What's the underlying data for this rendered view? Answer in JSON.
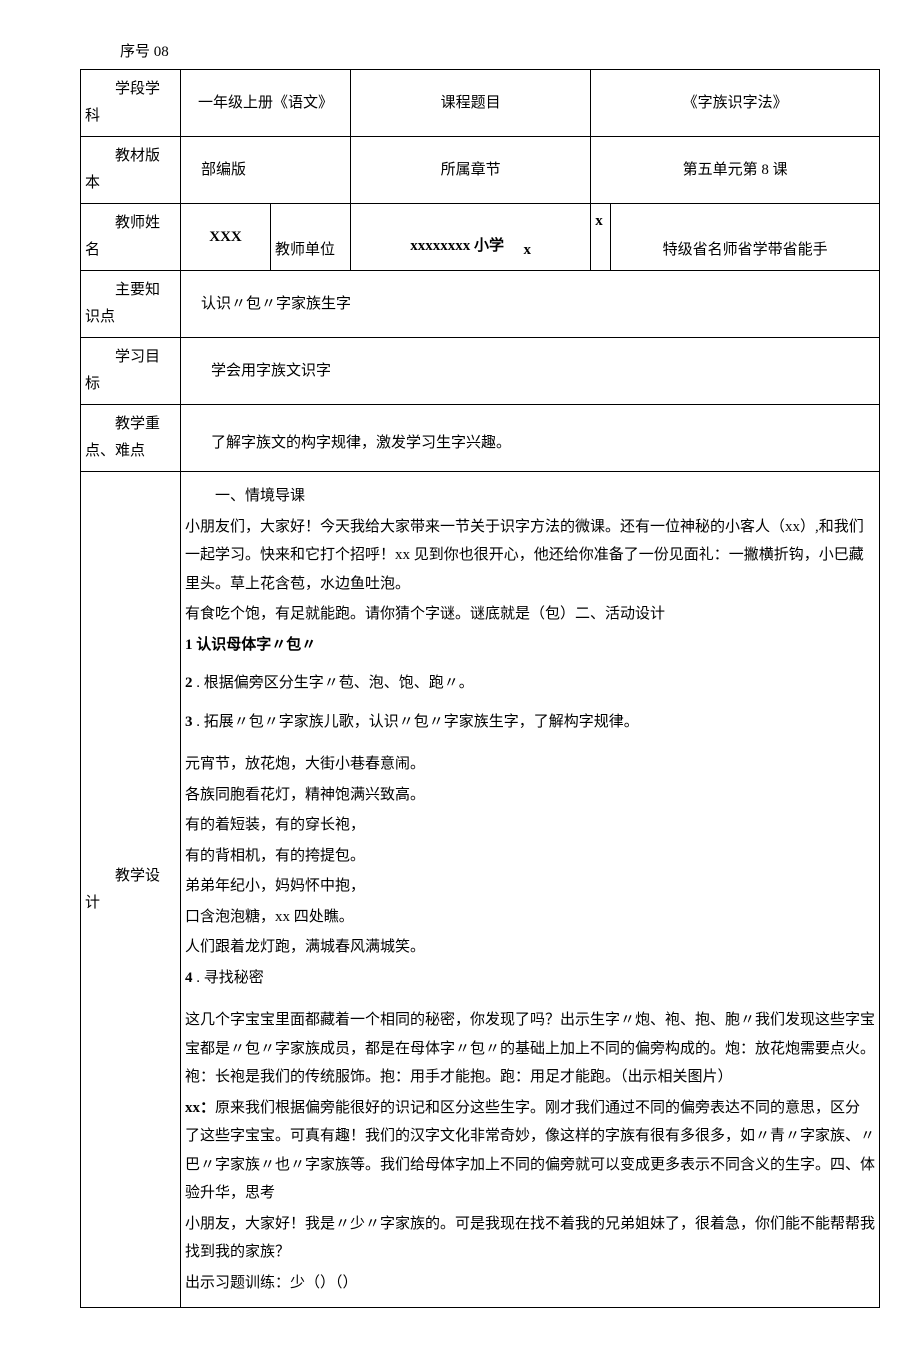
{
  "serial": "序号 08",
  "rows": {
    "r1": {
      "label1": "学段学",
      "label2": "科",
      "v1": "一年级上册《语文》",
      "label_mid": "课程题目",
      "v2": "《字族识字法》"
    },
    "r2": {
      "label1": "教材版",
      "label2": "本",
      "v1": "部编版",
      "label_mid": "所属章节",
      "v2": "第五单元第 8 课"
    },
    "r3": {
      "label1": "教师姓",
      "label2": "名",
      "v1": "XXX",
      "label_mid": "教师单位",
      "school": "xxxxxxxx 小学",
      "x1": "x",
      "x2": "x",
      "v2": "特级省名师省学带省能手"
    },
    "r4": {
      "label1": "主要知",
      "label2": "识点",
      "content": "认识〃包〃字家族生字"
    },
    "r5": {
      "label1": "学习目",
      "label2": "标",
      "content": "学会用字族文识字"
    },
    "r6": {
      "label1": "教学重",
      "label2": "点、难点",
      "content": "了解字族文的构字规律，激发学习生字兴趣。"
    },
    "r7": {
      "label1": "教学设",
      "label2": "计",
      "section1_title": "一、情境导课",
      "p1": "小朋友们，大家好！今天我给大家带来一节关于识字方法的微课。还有一位神秘的小客人（xx）,和我们一起学习。快来和它打个招呼！xx 见到你也很开心，他还给你准备了一份见面礼：一撇横折钩，小巳藏里头。草上花含苞，水边鱼吐泡。",
      "p2": "有食吃个饱，有足就能跑。请你猜个字谜。谜底就是（包）二、活动设计",
      "item1": "1 认识母体字〃包〃",
      "item2": "2 . 根据偏旁区分生字〃苞、泡、饱、跑〃。",
      "item3": "3 . 拓展〃包〃字家族儿歌，认识〃包〃字家族生字，了解构字规律。",
      "poem1": "元宵节，放花炮，大街小巷春意闹。",
      "poem2": "各族同胞看花灯，精神饱满兴致高。",
      "poem3": "有的着短装，有的穿长袍，",
      "poem4": "有的背相机，有的挎提包。",
      "poem5": "弟弟年纪小，妈妈怀中抱，",
      "poem6": "口含泡泡糖，xx 四处瞧。",
      "poem7": "人们跟着龙灯跑，满城春风满城笑。",
      "item4": "4 . 寻找秘密",
      "p3": "这几个字宝宝里面都藏着一个相同的秘密，你发现了吗？出示生字〃炮、袍、抱、胞〃我们发现这些字宝宝都是〃包〃字家族成员，都是在母体字〃包〃的基础上加上不同的偏旁构成的。炮：放花炮需要点火。袍：长袍是我们的传统服饰。抱：用手才能抱。跑：用足才能跑。（出示相关图片）",
      "p4_bold": "xx：",
      "p4": "原来我们根据偏旁能很好的识记和区分这些生字。刚才我们通过不同的偏旁表达不同的意思，区分了这些字宝宝。可真有趣！我们的汉字文化非常奇妙，像这样的字族有很有多很多，如〃青〃字家族、〃巴〃字家族〃也〃字家族等。我们给母体字加上不同的偏旁就可以变成更多表示不同含义的生字。四、体验升华，思考",
      "p5": "小朋友，大家好！我是〃少〃字家族的。可是我现在找不着我的兄弟姐妹了，很着急，你们能不能帮帮我找到我的家族？",
      "p6": "出示习题训练：少（）（）"
    }
  }
}
